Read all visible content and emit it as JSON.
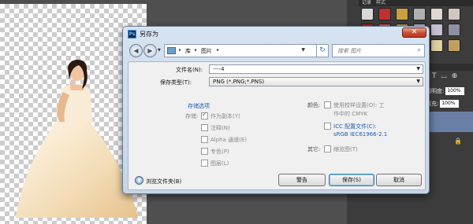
{
  "panel_tabs": [
    "记录",
    "样式"
  ],
  "swatches": [
    "#d8d8d8",
    "#c03030",
    "#c8a040",
    "#b0b0b0",
    "#e0d8d0",
    "#d0c8c0",
    "#b02828",
    "#e05050",
    "#c09850",
    "#b8b8b8",
    "#c8c0d0",
    "#9090a0",
    "#d0c080",
    "#c0d8e8",
    "#d8b040",
    "#a89070",
    "#e0d0a0",
    "#c0a060"
  ],
  "layers": {
    "tools": [
      "T",
      "⌴",
      "⊕"
    ],
    "opacity_label": "透明度:",
    "opacity_value": "100%",
    "fill_label": "填充:",
    "fill_value": "100%",
    "lock_icon": "lock-icon"
  },
  "dialog": {
    "title": "另存为",
    "app_icon": "Ps",
    "close_glyph": "✕",
    "nav": {
      "back_glyph": "◀",
      "forward_glyph": "▶",
      "path": [
        "库",
        "图片"
      ],
      "search_placeholder": "搜索 图片"
    },
    "filename_label": "文件名(N):",
    "filename_value": "----4",
    "filetype_label": "保存类型(T):",
    "filetype_value": "PNG (*.PNG;*.PNS)",
    "save_options_title": "存储选项",
    "save_label": "存储:",
    "options": [
      {
        "label": "作为副本(Y)",
        "checked": true
      },
      {
        "label": "注释(N)",
        "checked": false
      },
      {
        "label": "Alpha 通道(E)",
        "checked": false
      },
      {
        "label": "专色(P)",
        "checked": false
      },
      {
        "label": "图层(L)",
        "checked": false
      }
    ],
    "color_label": "颜色:",
    "proof_setup_line1": "使用校样设置(O):  工",
    "proof_setup_line2": "作中的 CMYK",
    "icc_line1": "ICC 配置文件(C):",
    "icc_line2": "sRGB IEC61966-2.1",
    "other_label": "其它:",
    "thumbnail_label": "缩览图(T)",
    "browse_label": "浏览文件夹(B)",
    "warning_button": "警告",
    "save_button": "保存(S)",
    "cancel_button": "取消"
  }
}
